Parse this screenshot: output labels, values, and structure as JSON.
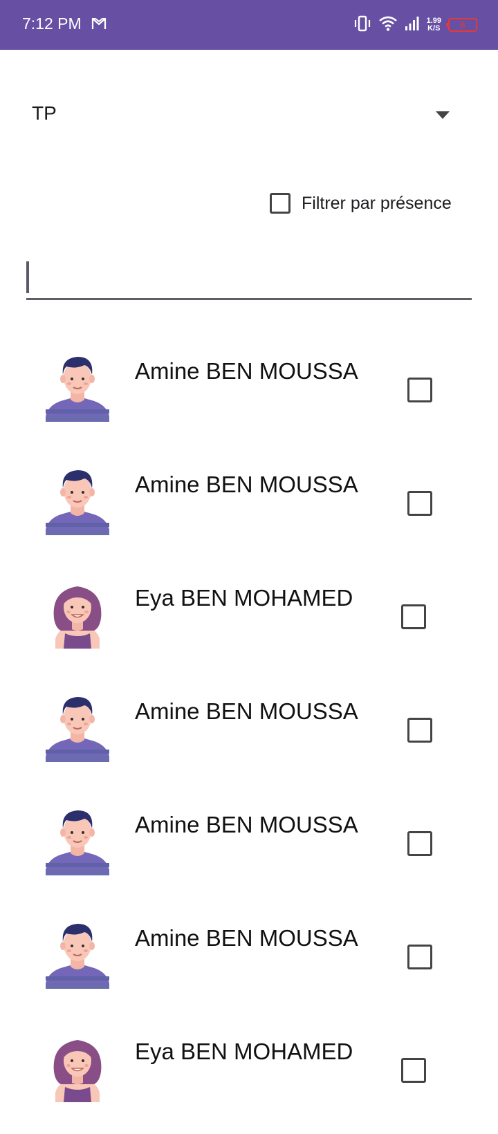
{
  "status_bar": {
    "time": "7:12 PM",
    "net_speed_value": "1.99",
    "net_speed_unit": "K/S",
    "battery": "8",
    "background": "#6750a4",
    "icons": [
      "gmail-icon",
      "vibrate-icon",
      "wifi-icon",
      "signal-icon",
      "battery-icon"
    ]
  },
  "dropdown": {
    "selected_value": "TP"
  },
  "filter": {
    "label": "Filtrer par présence",
    "checked": false
  },
  "search": {
    "value": ""
  },
  "students": [
    {
      "name": "Amine BEN MOUSSA",
      "avatar": "male-avatar",
      "present": false
    },
    {
      "name": "Amine BEN MOUSSA",
      "avatar": "male-avatar",
      "present": false
    },
    {
      "name": "Eya BEN MOHAMED",
      "avatar": "female-avatar",
      "present": false
    },
    {
      "name": "Amine BEN MOUSSA",
      "avatar": "male-avatar",
      "present": false
    },
    {
      "name": "Amine BEN MOUSSA",
      "avatar": "male-avatar",
      "present": false
    },
    {
      "name": "Amine BEN MOUSSA",
      "avatar": "male-avatar",
      "present": false
    },
    {
      "name": "Eya BEN MOHAMED",
      "avatar": "female-avatar",
      "present": false
    }
  ]
}
